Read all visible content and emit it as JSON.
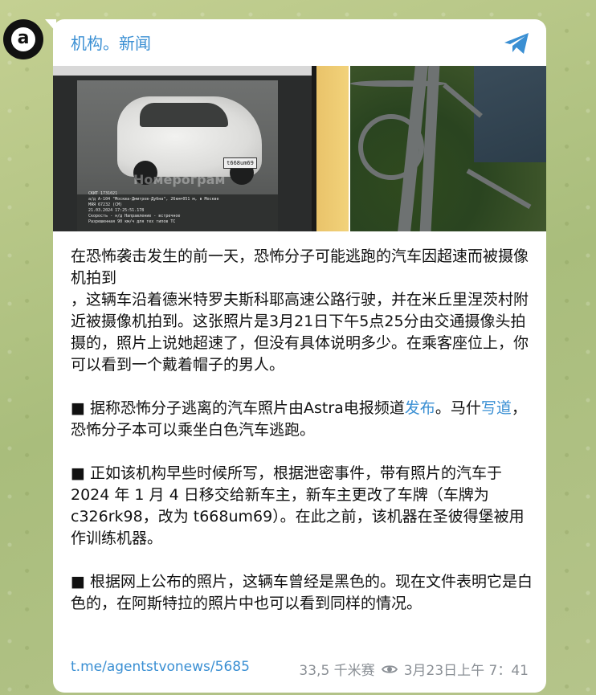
{
  "channel": {
    "name": "机构。新闻",
    "avatar_letter": "a"
  },
  "media": {
    "photo1_plate": "t668um69",
    "photo1_watermark": "Номерограм",
    "photo1_caption_lines": [
      "СКИТ 1731021",
      "а/д А-104 \"Москва-Дмитров-Дубна\", 26км+051 м, в Москве",
      "МЯЯ 67232 (СМ)",
      "21.03.2024 17:25:51.178",
      "Скорость - н/д Направление - встречное",
      "Разрешенная 90 км/ч для тех типов ТС"
    ]
  },
  "message": {
    "paragraph1": "在恐怖袭击发生的前一天，恐怖分子可能逃跑的汽车因超速而被摄像机拍到",
    "paragraph2": "，这辆车沿着德米特罗夫斯科耶高速公路行驶，并在米丘里涅茨村附近被摄像机拍到。这张照片是3月21日下午5点25分由交通摄像头拍摄的，照片上说她超速了，但没有具体说明多少。在乘客座位上，你可以看到一个戴着帽子的男人。",
    "bullet1_pre": "■ 据称恐怖分子逃离的汽车照片由Astra电报频道",
    "bullet1_link1": "发布",
    "bullet1_mid": "。马什",
    "bullet1_link2": "写道",
    "bullet1_post": "，恐怖分子本可以乘坐白色汽车逃跑。",
    "bullet2": "■ 正如该机构早些时候所写，根据泄密事件，带有照片的汽车于 2024 年 1 月 4 日移交给新车主，新车主更改了车牌（车牌为 c326rk98，改为 t668um69）。在此之前，该机器在圣彼得堡被用作训练机器。",
    "bullet3": "■ 根据网上公布的照片，这辆车曾经是黑色的。现在文件表明它是白色的，在阿斯特拉的照片中也可以看到同样的情况。"
  },
  "footer": {
    "link": "t.me/agentstvonews/5685",
    "views": "33,5 千米赛",
    "timestamp": "3月23日上午 7：41"
  },
  "colors": {
    "accent": "#3a8fd3",
    "meta": "#8a8f95"
  },
  "icons": {
    "share": "share-arrow-icon",
    "views": "eye-icon"
  }
}
